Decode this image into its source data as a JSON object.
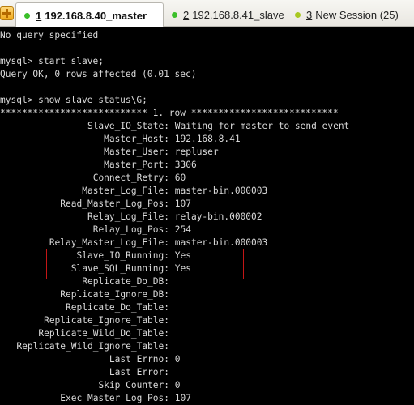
{
  "tabs": [
    {
      "number": "1",
      "label": "192.168.8.40_master",
      "active": true,
      "status_color": "#3bbf2a"
    },
    {
      "number": "2",
      "label": "192.168.8.41_slave",
      "active": false,
      "status_color": "#3bbf2a"
    },
    {
      "number": "3",
      "label": "New Session (25)",
      "active": false,
      "status_color": "#a8c820"
    }
  ],
  "terminal": {
    "lines": [
      "No query specified",
      "",
      "mysql> start slave;",
      "Query OK, 0 rows affected (0.01 sec)",
      "",
      "mysql> show slave status\\G;",
      "*************************** 1. row ***************************"
    ],
    "fields": [
      {
        "name": "Slave_IO_State:",
        "value": "Waiting for master to send event"
      },
      {
        "name": "Master_Host:",
        "value": "192.168.8.41"
      },
      {
        "name": "Master_User:",
        "value": "repluser"
      },
      {
        "name": "Master_Port:",
        "value": "3306"
      },
      {
        "name": "Connect_Retry:",
        "value": "60"
      },
      {
        "name": "Master_Log_File:",
        "value": "master-bin.000003"
      },
      {
        "name": "Read_Master_Log_Pos:",
        "value": "107"
      },
      {
        "name": "Relay_Log_File:",
        "value": "relay-bin.000002"
      },
      {
        "name": "Relay_Log_Pos:",
        "value": "254"
      },
      {
        "name": "Relay_Master_Log_File:",
        "value": "master-bin.000003"
      },
      {
        "name": "Slave_IO_Running:",
        "value": "Yes"
      },
      {
        "name": "Slave_SQL_Running:",
        "value": "Yes"
      },
      {
        "name": "Replicate_Do_DB:",
        "value": ""
      },
      {
        "name": "Replicate_Ignore_DB:",
        "value": ""
      },
      {
        "name": "Replicate_Do_Table:",
        "value": ""
      },
      {
        "name": "Replicate_Ignore_Table:",
        "value": ""
      },
      {
        "name": "Replicate_Wild_Do_Table:",
        "value": ""
      },
      {
        "name": "Replicate_Wild_Ignore_Table:",
        "value": ""
      },
      {
        "name": "Last_Errno:",
        "value": "0"
      },
      {
        "name": "Last_Error:",
        "value": ""
      },
      {
        "name": "Skip_Counter:",
        "value": "0"
      },
      {
        "name": "Exec_Master_Log_Pos:",
        "value": "107"
      }
    ],
    "highlight_color": "#c41616"
  }
}
